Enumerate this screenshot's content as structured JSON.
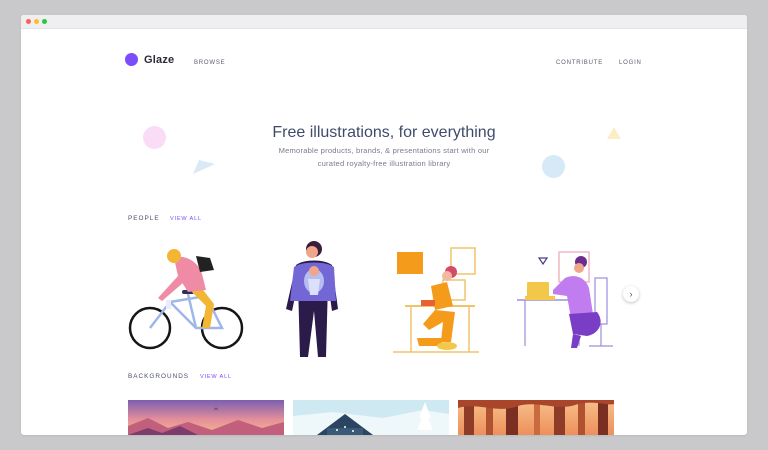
{
  "window": {
    "controls": [
      "close",
      "minimize",
      "zoom"
    ],
    "control_colors": [
      "#ff5f57",
      "#febc2e",
      "#28c840"
    ]
  },
  "nav": {
    "brand": "Glaze",
    "browse": "BROWSE",
    "contribute": "CONTRIBUTE",
    "login": "LOGIN"
  },
  "hero": {
    "title": "Free illustrations, for everything",
    "subtitle_line1": "Memorable products, brands, & presentations start with our",
    "subtitle_line2": "curated royalty-free illustration library"
  },
  "sections": {
    "people": {
      "title": "PEOPLE",
      "view_all": "VIEW ALL",
      "items": [
        "cyclist",
        "parent-with-baby",
        "person-at-desk",
        "woman-at-laptop"
      ],
      "next_icon": "chevron-right-icon"
    },
    "backgrounds": {
      "title": "BACKGROUNDS",
      "view_all": "VIEW ALL",
      "items": [
        "sunset-mountains",
        "snowy-cabin",
        "autumn-forest"
      ]
    }
  },
  "colors": {
    "accent": "#7b4dfb",
    "text_dark": "#3e4b6a",
    "text_muted": "#7a7d8c"
  }
}
